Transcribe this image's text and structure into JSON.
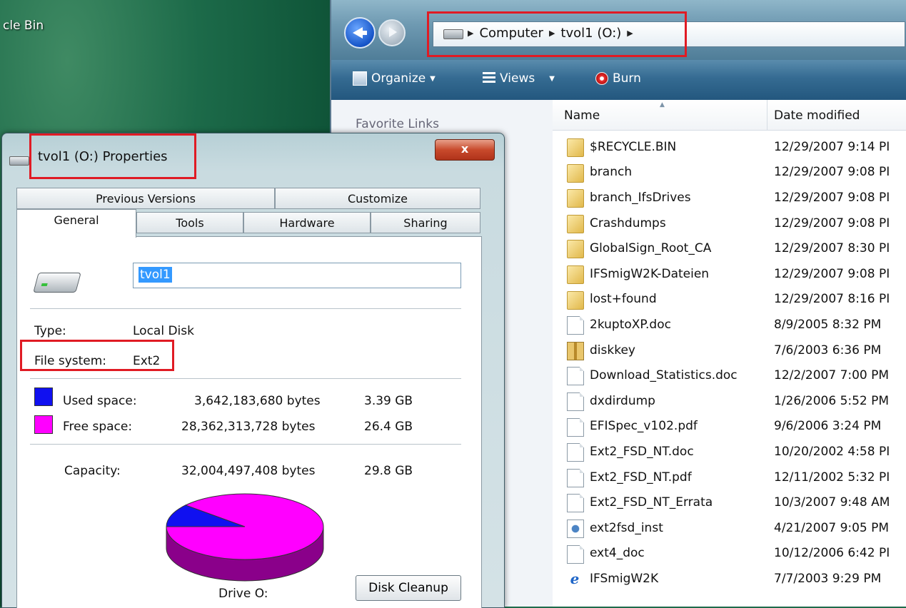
{
  "desktop": {
    "recycle_bin_label": "cle Bin"
  },
  "explorer": {
    "address": {
      "segments": [
        "Computer",
        "tvol1 (O:)"
      ]
    },
    "toolbar": {
      "organize": "Organize",
      "views": "Views",
      "burn": "Burn"
    },
    "favorites_title": "Favorite Links",
    "columns": {
      "name": "Name",
      "date": "Date modified"
    },
    "files": [
      {
        "name": "$RECYCLE.BIN",
        "date": "12/29/2007 9:14 PI",
        "icon": "folder-icon"
      },
      {
        "name": "branch",
        "date": "12/29/2007 9:08 PI",
        "icon": "folder-icon"
      },
      {
        "name": "branch_IfsDrives",
        "date": "12/29/2007 9:08 PI",
        "icon": "folder-icon"
      },
      {
        "name": "Crashdumps",
        "date": "12/29/2007 9:08 PI",
        "icon": "folder-icon"
      },
      {
        "name": "GlobalSign_Root_CA",
        "date": "12/29/2007 8:30 PI",
        "icon": "folder-icon"
      },
      {
        "name": "IFSmigW2K-Dateien",
        "date": "12/29/2007 9:08 PI",
        "icon": "folder-icon"
      },
      {
        "name": "lost+found",
        "date": "12/29/2007 8:16 PI",
        "icon": "folder-icon"
      },
      {
        "name": "2kuptoXP.doc",
        "date": "8/9/2005 8:32 PM",
        "icon": "document-icon"
      },
      {
        "name": "diskkey",
        "date": "7/6/2003 6:36 PM",
        "icon": "archive-icon"
      },
      {
        "name": "Download_Statistics.doc",
        "date": "12/2/2007 7:00 PM",
        "icon": "document-icon"
      },
      {
        "name": "dxdirdump",
        "date": "1/26/2006 5:52 PM",
        "icon": "document-icon"
      },
      {
        "name": "EFISpec_v102.pdf",
        "date": "9/6/2006 3:24 PM",
        "icon": "document-icon"
      },
      {
        "name": "Ext2_FSD_NT.doc",
        "date": "10/20/2002 4:58 PI",
        "icon": "document-icon"
      },
      {
        "name": "Ext2_FSD_NT.pdf",
        "date": "12/11/2002 5:32 PI",
        "icon": "document-icon"
      },
      {
        "name": "Ext2_FSD_NT_Errata",
        "date": "10/3/2007 9:48 AM",
        "icon": "document-icon"
      },
      {
        "name": "ext2fsd_inst",
        "date": "4/21/2007 9:05 PM",
        "icon": "setup-icon"
      },
      {
        "name": "ext4_doc",
        "date": "10/12/2006 6:42 PI",
        "icon": "document-icon"
      },
      {
        "name": "IFSmigW2K",
        "date": "7/7/2003 9:29 PM",
        "icon": "ie-icon"
      }
    ]
  },
  "dialog": {
    "title": "tvol1 (O:) Properties",
    "close_label": "x",
    "tabs": {
      "previous_versions": "Previous Versions",
      "customize": "Customize",
      "general": "General",
      "tools": "Tools",
      "hardware": "Hardware",
      "sharing": "Sharing"
    },
    "volume_label": "tvol1",
    "type_label": "Type:",
    "type_value": "Local Disk",
    "fs_label": "File system:",
    "fs_value": "Ext2",
    "used_label": "Used space:",
    "used_bytes": "3,642,183,680 bytes",
    "used_gb": "3.39 GB",
    "free_label": "Free space:",
    "free_bytes": "28,362,313,728 bytes",
    "free_gb": "26.4 GB",
    "capacity_label": "Capacity:",
    "capacity_bytes": "32,004,497,408 bytes",
    "capacity_gb": "29.8 GB",
    "drive_caption": "Drive O:",
    "disk_cleanup": "Disk Cleanup",
    "colors": {
      "used": "#1010f0",
      "free": "#ff00ff"
    },
    "chart_data": {
      "type": "pie",
      "slices": [
        {
          "value": 3642183680
        },
        {
          "value": 28362313728
        }
      ]
    }
  }
}
